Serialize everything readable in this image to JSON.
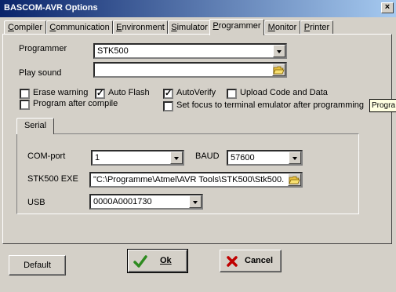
{
  "window": {
    "title": "BASCOM-AVR Options",
    "close_glyph": "×"
  },
  "tabs": [
    {
      "label": "Compiler",
      "underline": "C",
      "rest": "ompiler"
    },
    {
      "label": "Communication",
      "underline": "C",
      "rest": "ommunication"
    },
    {
      "label": "Environment",
      "underline": "E",
      "rest": "nvironment"
    },
    {
      "label": "Simulator",
      "underline": "S",
      "rest": "imulator"
    },
    {
      "label": "Programmer",
      "underline": "P",
      "rest": "rogrammer"
    },
    {
      "label": "Monitor",
      "underline": "M",
      "rest": "onitor"
    },
    {
      "label": "Printer",
      "underline": "P",
      "rest": "rinter"
    }
  ],
  "programmer": {
    "label": "Programmer",
    "value": "STK500"
  },
  "play_sound": {
    "label": "Play sound",
    "value": ""
  },
  "options": {
    "erase_warning": {
      "label": "Erase warning",
      "checked": false
    },
    "auto_flash": {
      "label": "Auto Flash",
      "checked": true
    },
    "auto_verify": {
      "label": "AutoVerify",
      "checked": true
    },
    "upload_code": {
      "label": "Upload Code and Data",
      "checked": false
    },
    "program_after_compile": {
      "label": "Program after compile",
      "checked": false
    },
    "set_focus": {
      "label": "Set focus to terminal emulator after programming",
      "checked": false
    }
  },
  "check_glyph": "✓",
  "serial": {
    "tab_label": "Serial",
    "com_label": "COM-port",
    "com_value": "1",
    "baud_label": "BAUD",
    "baud_value": "57600",
    "exe_label": "STK500 EXE",
    "exe_value": "\"C:\\Programme\\Atmel\\AVR Tools\\STK500\\Stk500.",
    "usb_label": "USB",
    "usb_value": "0000A0001730"
  },
  "buttons": {
    "default": "Default",
    "ok": "Ok",
    "cancel": "Cancel"
  },
  "tooltip": "Progra",
  "colors": {
    "ok_check": "#2e8b20",
    "cancel_x": "#c00000"
  }
}
